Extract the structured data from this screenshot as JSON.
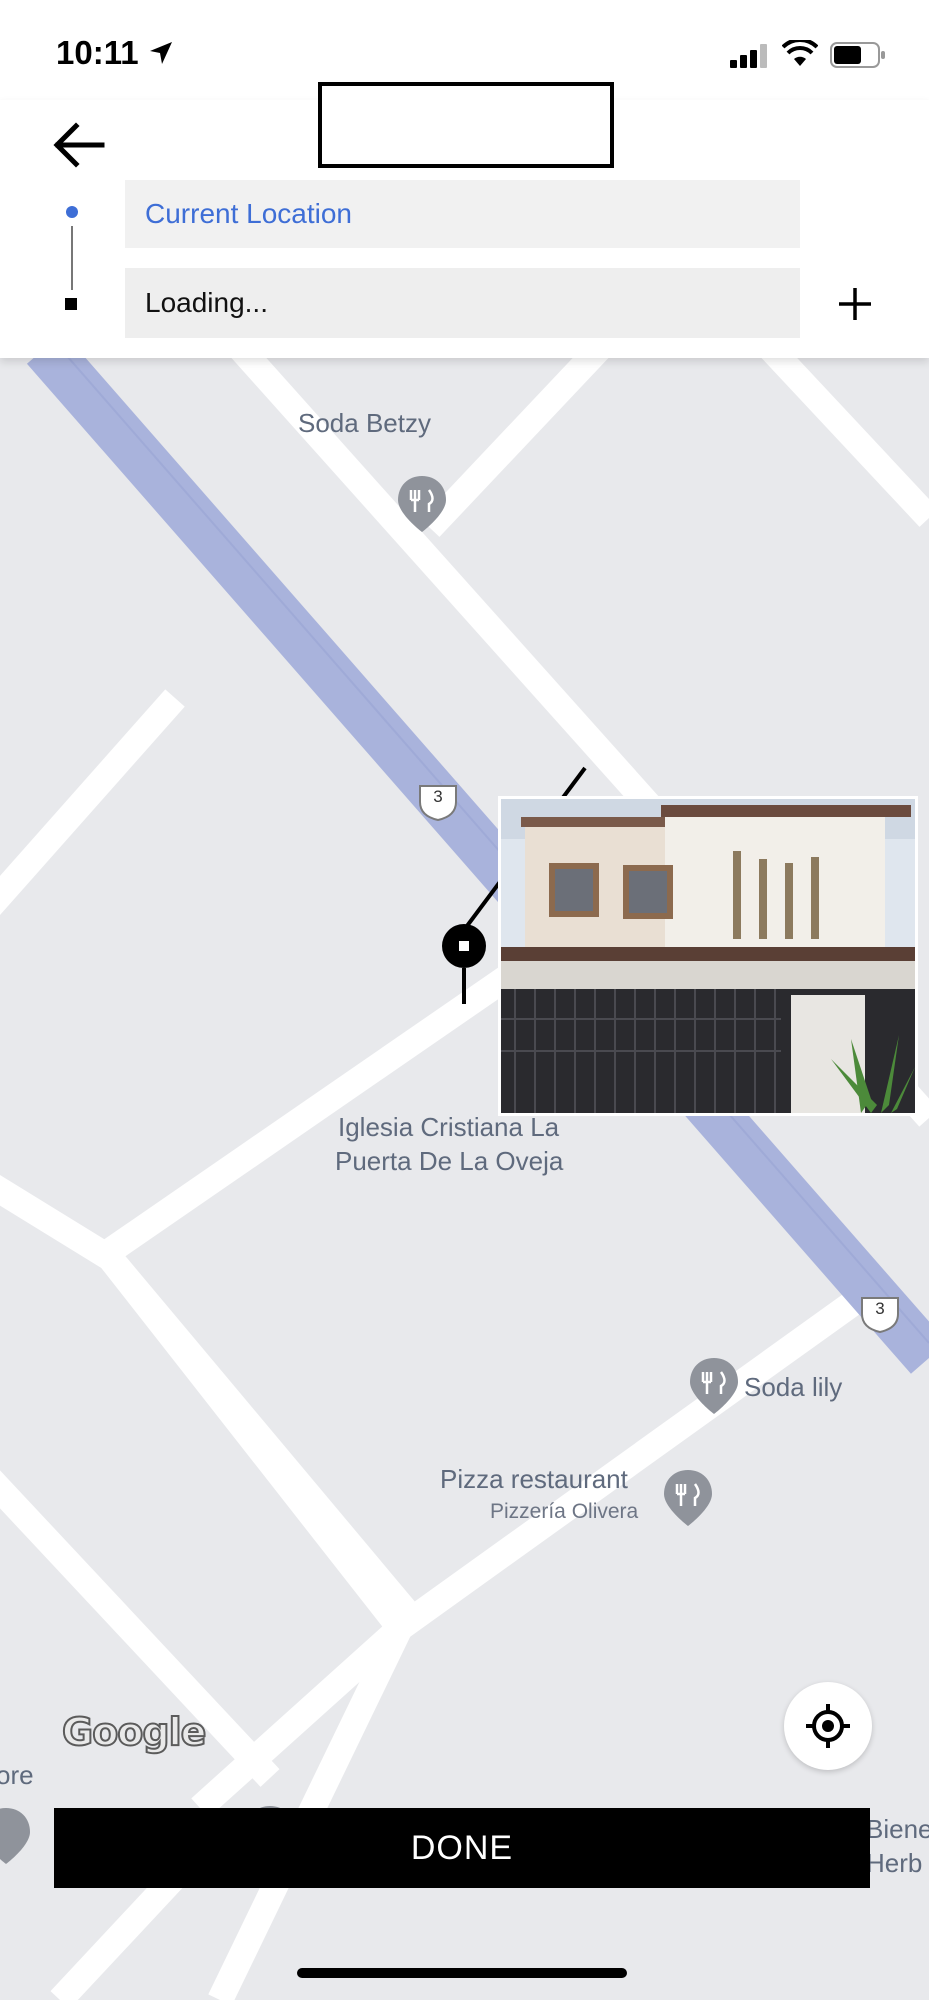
{
  "status_bar": {
    "time": "10:11",
    "icons": [
      "location-arrow-icon",
      "cellular-signal-icon",
      "wifi-icon",
      "battery-icon"
    ]
  },
  "header": {
    "back_icon": "arrow-left-icon",
    "pickup_text": "Current Location",
    "dropoff_text": "Loading...",
    "add_stop_icon": "plus-icon"
  },
  "map": {
    "pois": [
      {
        "name": "Soda Betzy",
        "icon": "restaurant-pin-icon"
      },
      {
        "name": "Iglesia Cristiana La",
        "name_line2": "Puerta De La Oveja",
        "icon": "church-pin-icon"
      },
      {
        "name": "Soda lily",
        "icon": "restaurant-pin-icon"
      },
      {
        "name": "Pizza restaurant",
        "subtitle": "Pizzería Olivera",
        "icon": "restaurant-pin-icon"
      }
    ],
    "route_shields": [
      "3",
      "3"
    ],
    "edge_labels": {
      "left": "ore",
      "right_line1": "Biene",
      "right_line2": "Herb"
    },
    "attribution": "Google",
    "locate_icon": "crosshair-icon"
  },
  "actions": {
    "done_label": "DONE"
  },
  "colors": {
    "accent": "#3e6ed6",
    "highway": "#a9b3dc",
    "map_bg": "#e8e9ec",
    "road": "#ffffff",
    "button": "#000000"
  }
}
